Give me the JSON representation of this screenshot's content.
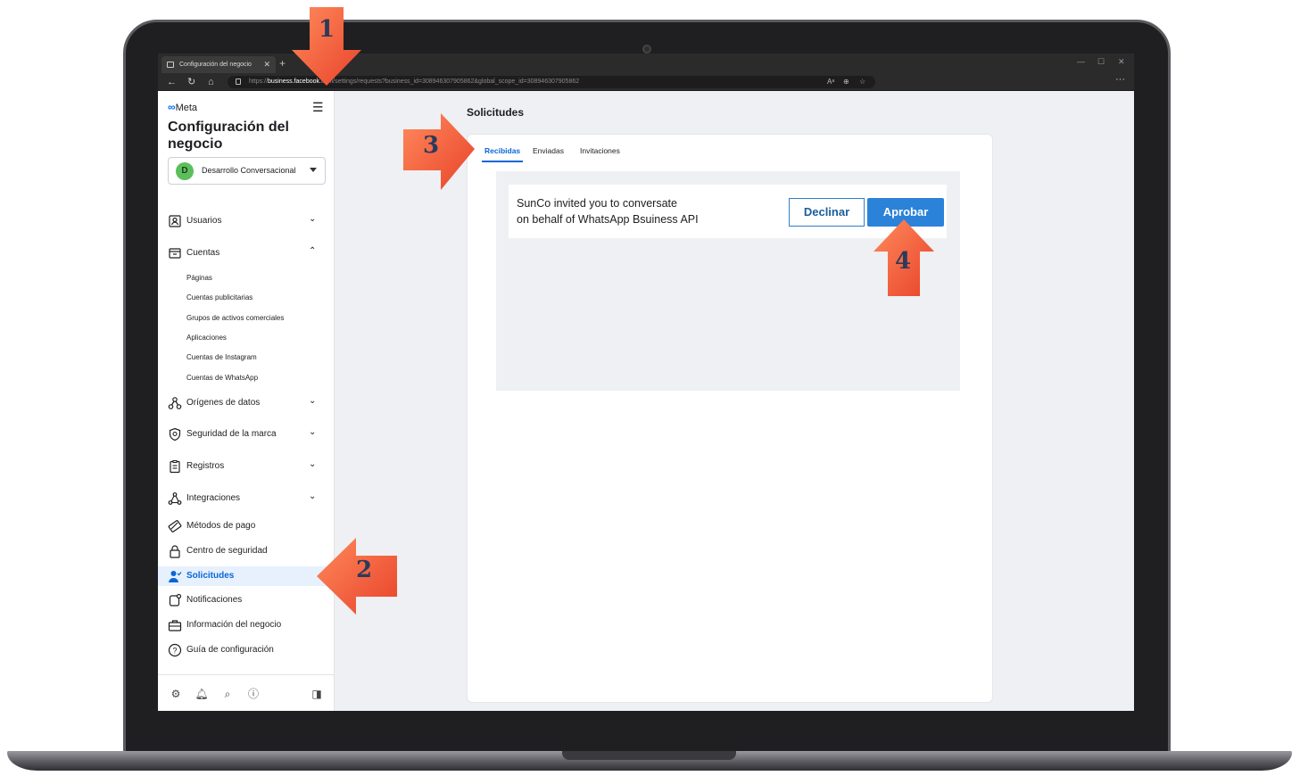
{
  "browser": {
    "tab_title": "Configuración del negocio",
    "new_tab": "+",
    "url_prefix": "https://",
    "url_host": "business.facebook.",
    "url_rest": "com/settings/requests?business_id=308946307905862&global_scope_id=308946307905862",
    "more": "···"
  },
  "sidebar": {
    "logo_text": "Meta",
    "title": "Configuración del negocio",
    "account": {
      "initial": "D",
      "name": "Desarrollo Conversacional"
    },
    "items": [
      {
        "label": "Usuarios",
        "icon": "users-icon",
        "chevron": "chevron-down"
      },
      {
        "label": "Cuentas",
        "icon": "accounts-icon",
        "chevron": "chevron-up"
      },
      {
        "label": "Orígenes de datos",
        "icon": "data-sources-icon",
        "chevron": "chevron-down"
      },
      {
        "label": "Seguridad de la marca",
        "icon": "shield-icon",
        "chevron": "chevron-down"
      },
      {
        "label": "Registros",
        "icon": "clipboard-icon",
        "chevron": "chevron-down"
      },
      {
        "label": "Integraciones",
        "icon": "integrations-icon",
        "chevron": "chevron-down"
      },
      {
        "label": "Métodos de pago",
        "icon": "payment-icon"
      },
      {
        "label": "Centro de seguridad",
        "icon": "lock-icon"
      },
      {
        "label": "Solicitudes",
        "icon": "requests-icon",
        "active": true
      },
      {
        "label": "Notificaciones",
        "icon": "notifications-icon"
      },
      {
        "label": "Información del negocio",
        "icon": "briefcase-icon"
      },
      {
        "label": "Guía de configuración",
        "icon": "help-icon"
      }
    ],
    "subitems": [
      "Páginas",
      "Cuentas publicitarias",
      "Grupos de activos comerciales",
      "Aplicaciones",
      "Cuentas de Instagram",
      "Cuentas de WhatsApp"
    ],
    "bottom_icons": [
      "gear-icon",
      "bell-icon",
      "search-icon",
      "help-icon",
      "panel-toggle-icon"
    ]
  },
  "main": {
    "title": "Solicitudes",
    "tabs": [
      "Recibidas",
      "Enviadas",
      "Invitaciones"
    ],
    "invite": {
      "line1": "SunCo invited you to conversate",
      "line2": "on behalf of WhatsApp Bsuiness API",
      "decline": "Declinar",
      "approve": "Aprobar"
    }
  },
  "annotations": [
    "1",
    "2",
    "3",
    "4"
  ],
  "colors": {
    "accent": "#0a66d6",
    "approve": "#2b82d9",
    "arrow": "#f05a3c",
    "active_bg": "#e7f0fd"
  }
}
